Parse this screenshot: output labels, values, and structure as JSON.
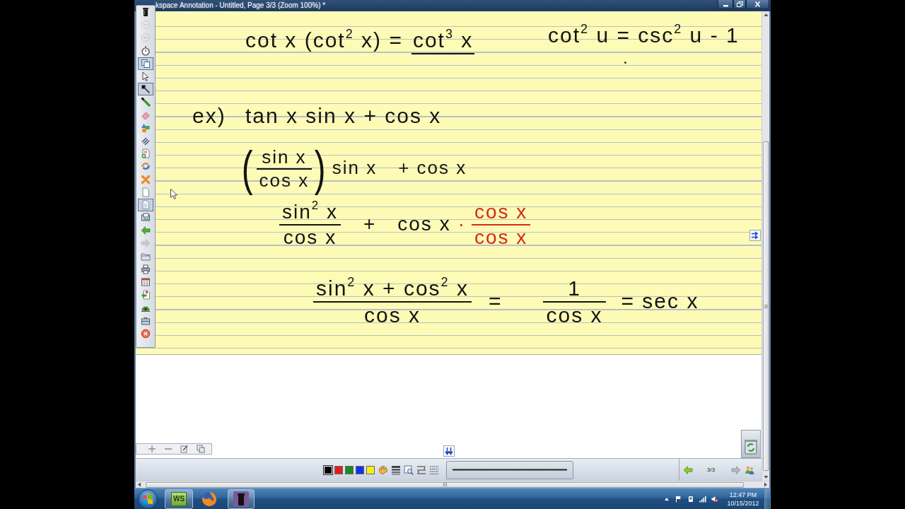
{
  "window": {
    "title": "kspace Annotation - Untitled, Page 3/3 (Zoom 100%) *"
  },
  "toolbar": {
    "tools": [
      {
        "selected": false,
        "disabled": false
      },
      {
        "selected": false,
        "disabled": true
      },
      {
        "selected": false,
        "disabled": true
      },
      {
        "selected": false,
        "disabled": false
      },
      {
        "selected": true,
        "disabled": false
      },
      {
        "selected": false,
        "disabled": false
      },
      {
        "selected": true,
        "disabled": false
      },
      {
        "selected": false,
        "disabled": false
      },
      {
        "selected": false,
        "disabled": false
      },
      {
        "selected": false,
        "disabled": false
      },
      {
        "selected": false,
        "disabled": false
      },
      {
        "selected": false,
        "disabled": false
      },
      {
        "selected": false,
        "disabled": false
      },
      {
        "selected": false,
        "disabled": false
      },
      {
        "selected": false,
        "disabled": false
      },
      {
        "selected": true,
        "disabled": false
      },
      {
        "selected": false,
        "disabled": false
      },
      {
        "selected": false,
        "disabled": false
      },
      {
        "selected": false,
        "disabled": true
      },
      {
        "selected": false,
        "disabled": false
      },
      {
        "selected": false,
        "disabled": false
      },
      {
        "selected": false,
        "disabled": false
      },
      {
        "selected": false,
        "disabled": false
      },
      {
        "selected": false,
        "disabled": false
      },
      {
        "selected": false,
        "disabled": false
      },
      {
        "selected": false,
        "disabled": false
      }
    ]
  },
  "ink": [
    {
      "terms": [
        {
          "kind": "text",
          "text": "cot x (cot$^{2}$ x) =",
          "color": "#141414",
          "underlined": false
        },
        {
          "kind": "text",
          "text": "cot$^{3}$ x",
          "color": "#141414",
          "underlined": true
        }
      ]
    },
    {
      "terms": [
        {
          "kind": "text",
          "text": "cot$^{2}$ u = csc$^{2}$ u - 1",
          "color": "#141414",
          "underlined": false
        }
      ]
    },
    {
      "terms": [
        {
          "kind": "text",
          "text": "ex)",
          "color": "#141414",
          "underlined": false
        }
      ]
    },
    {
      "terms": [
        {
          "kind": "text",
          "text": "tan x sin x + cos x",
          "color": "#141414",
          "underlined": false
        }
      ]
    },
    {
      "terms": [
        {
          "kind": "paren_fraction",
          "open": "(",
          "numerator": "sin x",
          "denominator": "cos x",
          "close": ")",
          "color": "#141414"
        },
        {
          "kind": "text",
          "text": "sin x",
          "color": "#141414",
          "underlined": false
        },
        {
          "kind": "text",
          "text": "+ cos x",
          "color": "#141414",
          "underlined": false
        }
      ]
    },
    {
      "terms": [
        {
          "kind": "fraction",
          "numerator": "sin$^{2}$ x",
          "denominator": "cos x",
          "color": "#141414"
        },
        {
          "kind": "text",
          "text": "+",
          "color": "#141414",
          "underlined": false
        },
        {
          "kind": "text",
          "text": "cos x",
          "color": "#141414",
          "underlined": false
        },
        {
          "kind": "text",
          "text": "·",
          "color": "#d42a1f",
          "underlined": false
        },
        {
          "kind": "fraction",
          "numerator": "cos x",
          "denominator": "cos x",
          "color": "#d42a1f"
        }
      ]
    },
    {
      "terms": [
        {
          "kind": "fraction",
          "numerator": "sin$^{2}$ x + cos$^{2}$ x",
          "denominator": "cos x",
          "color": "#141414"
        },
        {
          "kind": "text",
          "text": "=",
          "color": "#141414",
          "underlined": false
        },
        {
          "kind": "fraction",
          "numerator": "1",
          "denominator": "cos x",
          "color": "#141414"
        },
        {
          "kind": "text",
          "text": "= sec x",
          "color": "#141414",
          "underlined": false
        }
      ]
    }
  ],
  "pen_colors": [
    {
      "color": "#000000",
      "selected": true
    },
    {
      "color": "#e41b1b",
      "selected": false
    },
    {
      "color": "#1e8a1e",
      "selected": false
    },
    {
      "color": "#1030f0",
      "selected": false
    },
    {
      "color": "#f4ef10",
      "selected": false
    }
  ],
  "page_nav": {
    "label": "3/3",
    "back_enabled": true,
    "forward_enabled": false
  },
  "taskbar": {
    "apps": [
      {
        "kind": "logo",
        "label": "WS",
        "running": true
      },
      {
        "kind": "globe",
        "running": false
      },
      {
        "kind": "canister",
        "running": true
      }
    ],
    "clock": {
      "time": "12:47 PM",
      "date": "10/15/2012"
    }
  }
}
